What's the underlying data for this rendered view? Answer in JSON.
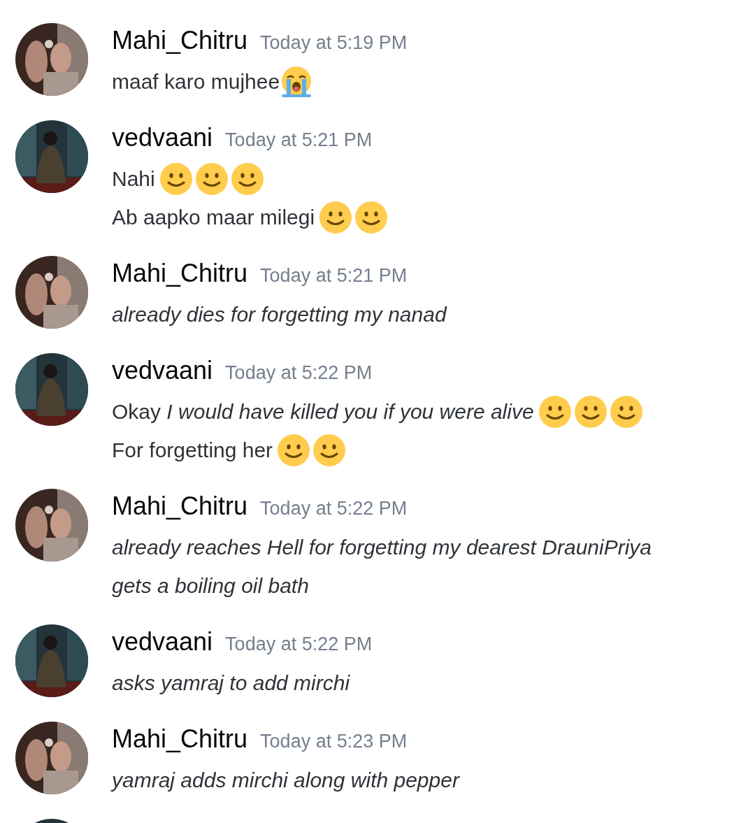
{
  "messages": [
    {
      "author": "Mahi_Chitru",
      "time": "Today at 5:19 PM",
      "lines": [
        {
          "italic": false,
          "parts": [
            {
              "kind": "text",
              "text": "maaf karo mujhee"
            },
            {
              "kind": "cry"
            }
          ]
        }
      ]
    },
    {
      "author": "vedvaani",
      "time": "Today at 5:21 PM",
      "lines": [
        {
          "italic": false,
          "parts": [
            {
              "kind": "text",
              "text": "Nahi"
            },
            {
              "kind": "smile"
            },
            {
              "kind": "smile"
            },
            {
              "kind": "smile"
            }
          ]
        },
        {
          "italic": false,
          "parts": [
            {
              "kind": "text",
              "text": "Ab aapko maar milegi"
            },
            {
              "kind": "smile"
            },
            {
              "kind": "smile"
            }
          ]
        }
      ]
    },
    {
      "author": "Mahi_Chitru",
      "time": "Today at 5:21 PM",
      "lines": [
        {
          "italic": true,
          "parts": [
            {
              "kind": "text",
              "text": "already dies for forgetting my nanad"
            }
          ]
        }
      ]
    },
    {
      "author": "vedvaani",
      "time": "Today at 5:22 PM",
      "lines": [
        {
          "italic": false,
          "parts": [
            {
              "kind": "text",
              "text": "Okay *I would have killed you if you were alive*"
            },
            {
              "kind": "smile"
            },
            {
              "kind": "smile"
            },
            {
              "kind": "smile"
            }
          ]
        },
        {
          "italic": false,
          "parts": [
            {
              "kind": "text",
              "text": "For forgetting her"
            },
            {
              "kind": "smile"
            },
            {
              "kind": "smile"
            }
          ]
        }
      ]
    },
    {
      "author": "Mahi_Chitru",
      "time": "Today at 5:22 PM",
      "lines": [
        {
          "italic": true,
          "parts": [
            {
              "kind": "text",
              "text": "already reaches Hell for forgetting my dearest DrauniPriya"
            }
          ]
        },
        {
          "italic": true,
          "parts": [
            {
              "kind": "text",
              "text": "gets a boiling oil bath"
            }
          ]
        }
      ]
    },
    {
      "author": "vedvaani",
      "time": "Today at 5:22 PM",
      "lines": [
        {
          "italic": true,
          "parts": [
            {
              "kind": "text",
              "text": "asks yamraj to add mirchi"
            }
          ]
        }
      ]
    },
    {
      "author": "Mahi_Chitru",
      "time": "Today at 5:23 PM",
      "lines": [
        {
          "italic": true,
          "parts": [
            {
              "kind": "text",
              "text": "yamraj adds mirchi along with pepper"
            }
          ]
        }
      ]
    }
  ]
}
